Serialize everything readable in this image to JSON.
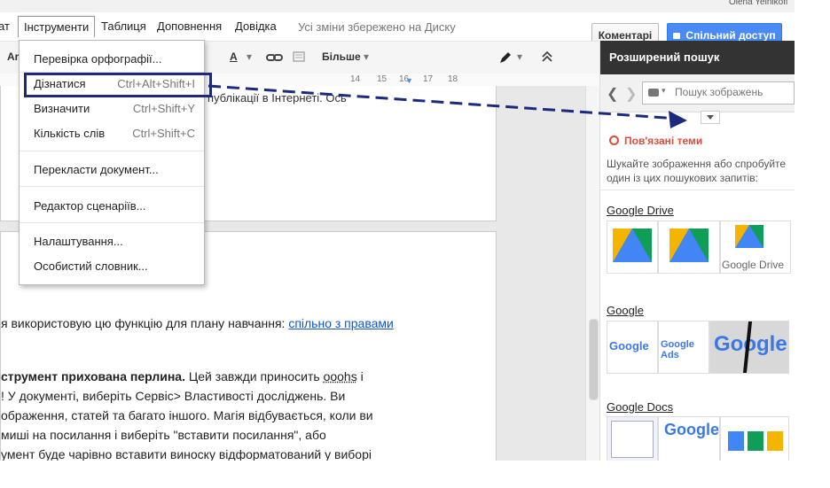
{
  "user": "Olena Yelnikoff",
  "menubar": {
    "items": [
      "ат",
      "Інструменти",
      "Таблиця",
      "Доповнення",
      "Довідка"
    ],
    "saved_status": "Усі зміни збережено на Диску"
  },
  "header": {
    "comments_label": "Коментарі",
    "share_label": "Спільний доступ"
  },
  "toolbar": {
    "font_partial": "Ar",
    "more_label": "Більше",
    "text_color_glyph": "A"
  },
  "ruler": {
    "marks": [
      "14",
      "15",
      "16",
      "17",
      "18"
    ]
  },
  "tools_menu": {
    "items": [
      {
        "label": "Перевірка орфографії...",
        "shortcut": ""
      },
      {
        "label": "Дізнатися",
        "shortcut": "Ctrl+Alt+Shift+I"
      },
      {
        "label": "Визначити",
        "shortcut": "Ctrl+Shift+Y"
      },
      {
        "label": "Кількість слів",
        "shortcut": "Ctrl+Shift+C"
      },
      {
        "label": "Перекласти документ...",
        "shortcut": ""
      },
      {
        "label": "Редактор сценаріїв...",
        "shortcut": ""
      },
      {
        "label": "Налаштування...",
        "shortcut": ""
      },
      {
        "label": "Особистий словник...",
        "shortcut": ""
      }
    ]
  },
  "document": {
    "page1_line": "публікації в Інтернеті. Ось",
    "page2_line1": "я використовую цю функцію для плану навчання:",
    "page2_link": "спільно з правами",
    "para_bold": "струмент прихована перлина.",
    "para_rest1": " Цей завжди приносить ",
    "para_oohs": "ooohs",
    "para_rest1b": " і",
    "para_line2": "! У документі, виберіть Сервіс> Властивості досліджень. Ви",
    "para_line3": "ображення, статей та багато іншого. Магія відбувається, коли ви",
    "para_line4": "миші на посилання і виберіть \"вставити посилання\", або",
    "para_line5": "умент буде чарівно вставити виноску відформатований у виборі"
  },
  "panel": {
    "title": "Розширений пошук",
    "search_placeholder": "Пошук зображень",
    "related_title": "Пов'язані теми",
    "hint": "Шукайте зображення або спробуйте один із цих пошукових запитів:",
    "groups": [
      {
        "title": "Google Drive",
        "thumbs": [
          "Google Drive logo",
          "Google Drive logo",
          "Google Drive"
        ]
      },
      {
        "title": "Google",
        "thumbs": [
          "Google",
          "Google Ads",
          "Google"
        ]
      },
      {
        "title": "Google Docs",
        "thumbs": [
          "Google Docs screenshot",
          "Google Docs",
          "Google Docs apps"
        ]
      }
    ],
    "thumb_texts": {
      "drive_caption": "Google Drive",
      "google": "Google",
      "google_ads": "Google Ads",
      "docs": "Google"
    }
  },
  "colors": {
    "accent": "#4a8af4",
    "highlight_box": "#1b2a7e",
    "related": "#dd4b39"
  }
}
